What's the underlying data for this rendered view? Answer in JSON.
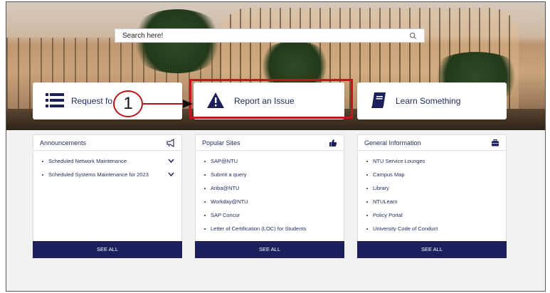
{
  "search": {
    "placeholder": "Search here!"
  },
  "actions": [
    {
      "label": "Request fo",
      "icon": "list-icon"
    },
    {
      "label": "Report an Issue",
      "icon": "warning-icon"
    },
    {
      "label": "Learn Something",
      "icon": "book-icon"
    }
  ],
  "annotation": {
    "number": "1",
    "highlight_color": "#c4161c"
  },
  "panels": {
    "announcements": {
      "title": "Announcements",
      "icon": "megaphone-icon",
      "items": [
        "Scheduled Network Maintenance",
        "Scheduled Systems Maintenance for 2023"
      ],
      "see_all": "SEE ALL"
    },
    "popular": {
      "title": "Popular Sites",
      "icon": "thumbs-up-icon",
      "items": [
        "SAP@NTU",
        "Submit a query",
        "Ariba@NTU",
        "Workday@NTU",
        "SAP Concur",
        "Letter of Certification (LOC) for Students"
      ],
      "see_all": "SEE ALL"
    },
    "general": {
      "title": "General Information",
      "icon": "briefcase-icon",
      "items": [
        "NTU Service Lounges",
        "Campus Map",
        "Library",
        "NTULearn",
        "Policy Portal",
        "University Code of Conduct"
      ],
      "see_all": "SEE ALL"
    }
  },
  "colors": {
    "navy": "#1b1f5b",
    "text": "#1c2a5e",
    "accent_red": "#c4161c"
  }
}
